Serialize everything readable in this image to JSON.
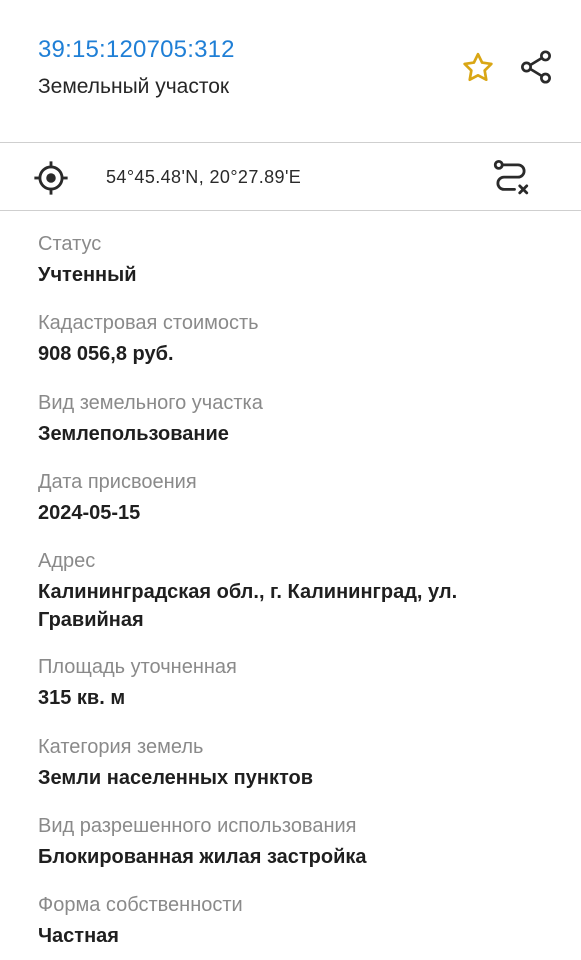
{
  "header": {
    "cadastral_number": "39:15:120705:312",
    "object_type": "Земельный участок"
  },
  "coordinates": {
    "text": "54°45.48'N, 20°27.89'E"
  },
  "colors": {
    "link": "#1f7fd6",
    "star": "#d9a615",
    "label": "#8a8a8a"
  },
  "details": [
    {
      "label": "Статус",
      "value": "Учтенный"
    },
    {
      "label": "Кадастровая стоимость",
      "value": "908 056,8 руб."
    },
    {
      "label": "Вид земельного участка",
      "value": "Землепользование"
    },
    {
      "label": "Дата присвоения",
      "value": "2024-05-15"
    },
    {
      "label": "Адрес",
      "value": "Калининградская обл., г. Калининград, ул. Гравийная"
    },
    {
      "label": "Площадь уточненная",
      "value": "315 кв. м"
    },
    {
      "label": "Категория земель",
      "value": "Земли населенных пунктов"
    },
    {
      "label": "Вид разрешенного использования",
      "value": "Блокированная жилая застройка"
    },
    {
      "label": "Форма собственности",
      "value": "Частная"
    }
  ]
}
